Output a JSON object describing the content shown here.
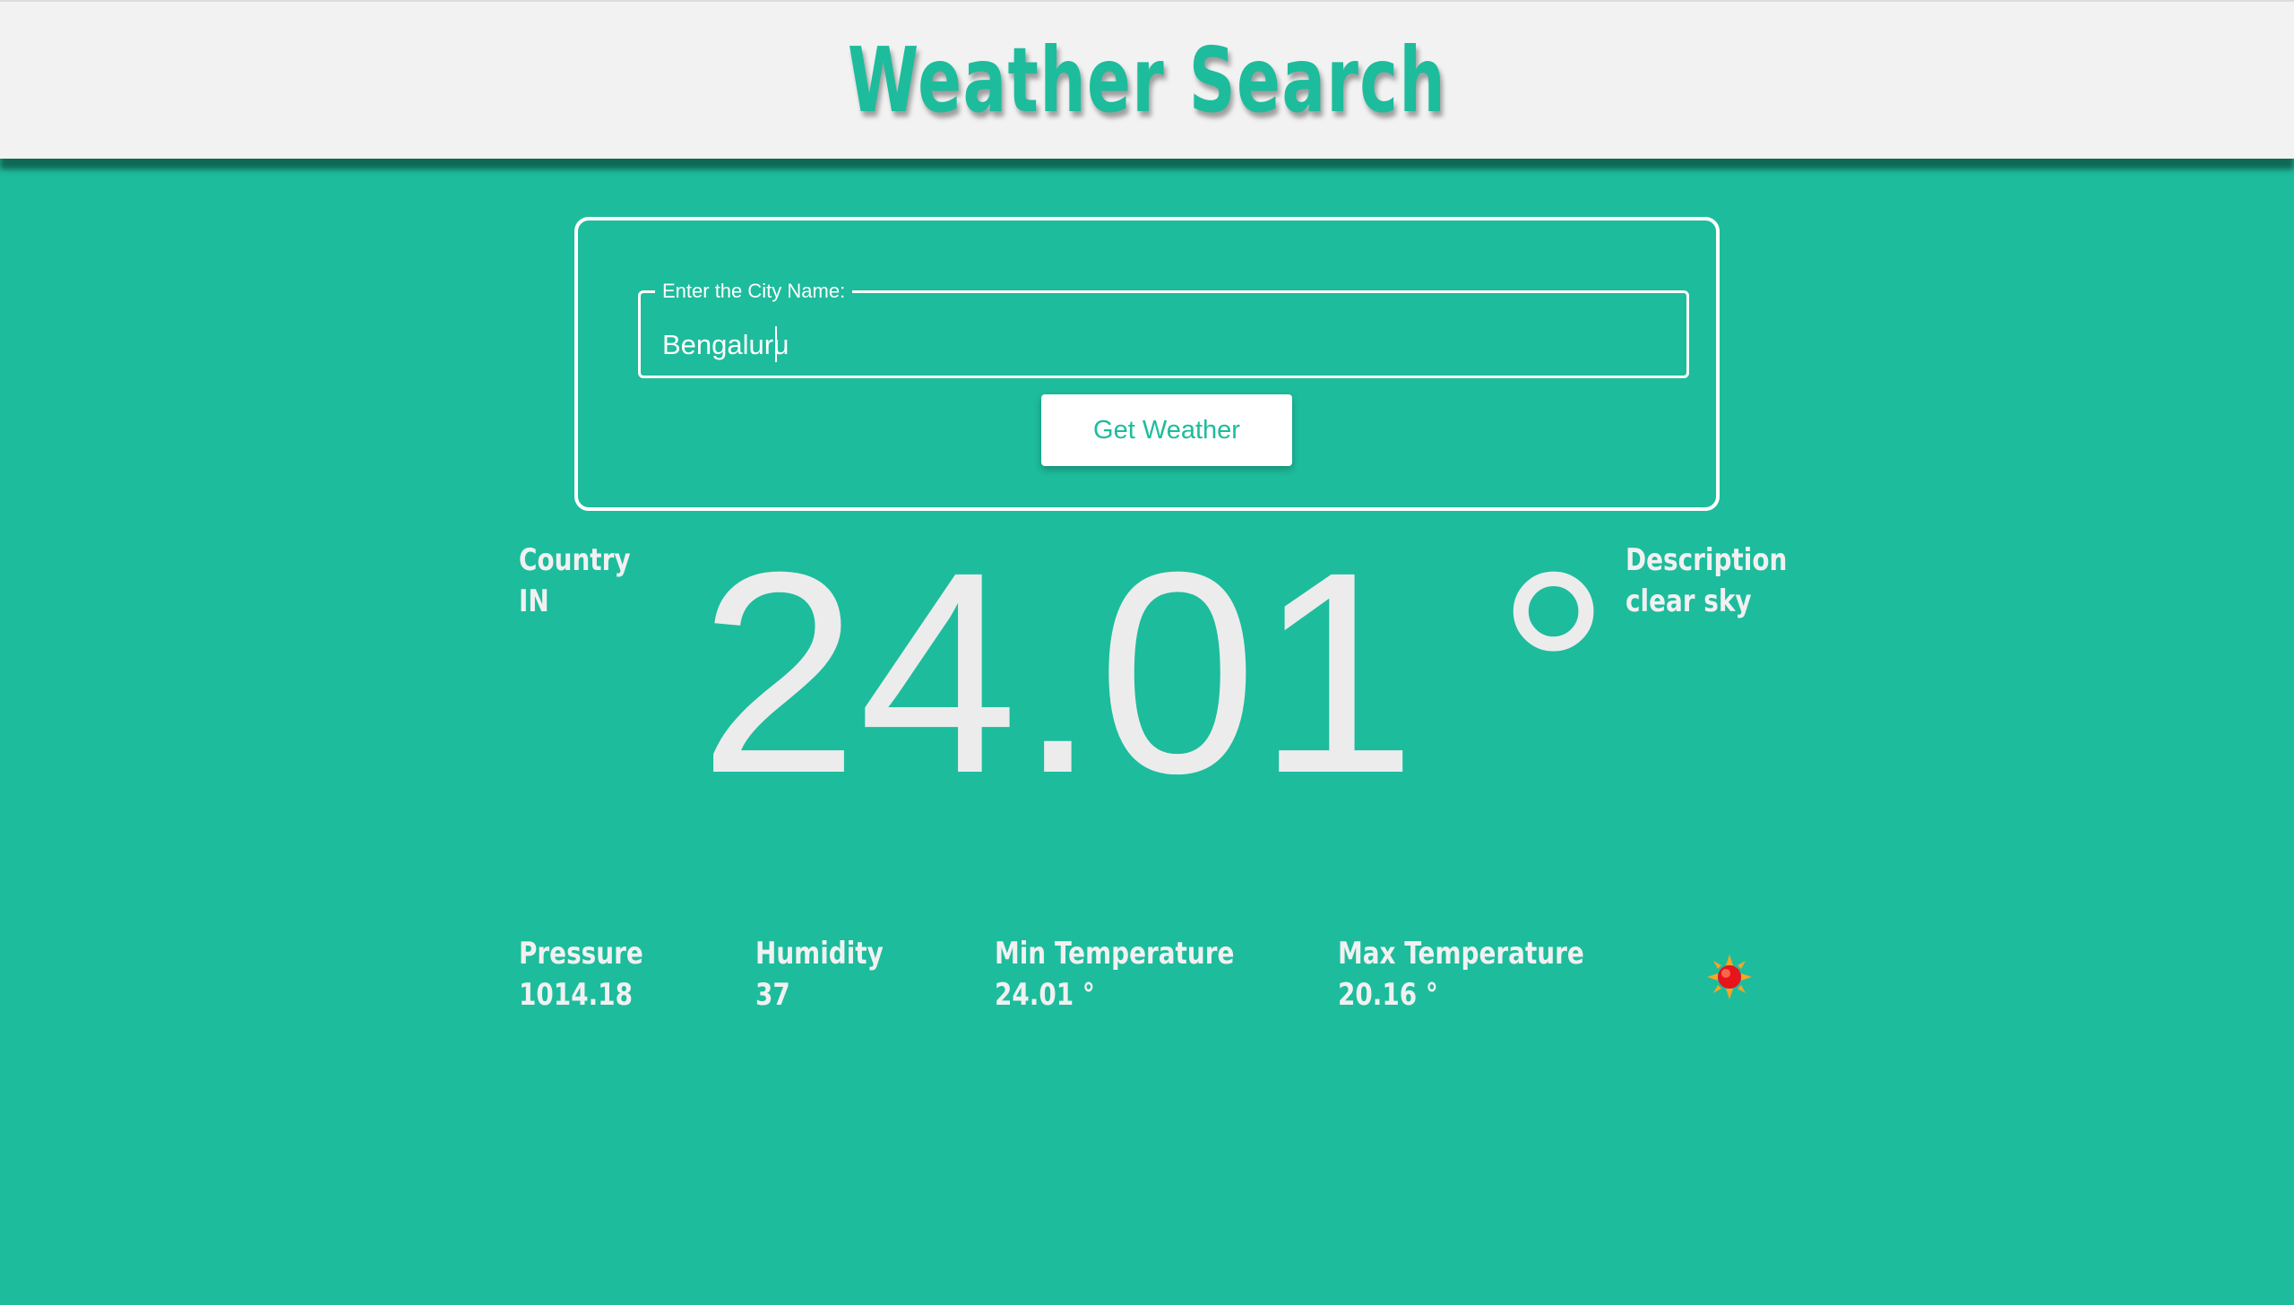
{
  "header": {
    "title": "Weather Search"
  },
  "search": {
    "legend": "Enter the City Name:",
    "value": "Bengaluru",
    "button_label": "Get Weather"
  },
  "weather": {
    "country_label": "Country",
    "country_value": "IN",
    "temperature": "24.01 °",
    "description_label": "Description",
    "description_value": "clear sky",
    "pressure_label": "Pressure",
    "pressure_value": "1014.18",
    "humidity_label": "Humidity",
    "humidity_value": "37",
    "min_temp_label": "Min Temperature",
    "min_temp_value": "24.01 °",
    "max_temp_label": "Max Temperature",
    "max_temp_value": "20.16 °",
    "icon": "sun-icon"
  },
  "colors": {
    "background": "#1dbc9c",
    "header_bg": "#f2f2f2",
    "accent": "#1dbc9c",
    "text_light": "#f1f1f1"
  }
}
